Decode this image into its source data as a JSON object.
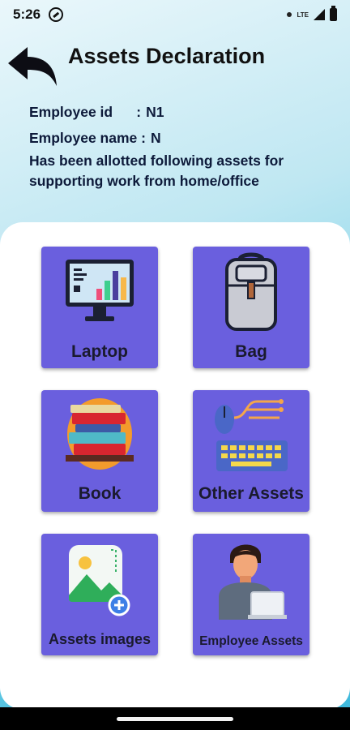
{
  "status_bar": {
    "time": "5:26",
    "network": "LTE"
  },
  "header": {
    "title": "Assets Declaration"
  },
  "employee": {
    "id_label": "Employee id      :",
    "id_value": "N1",
    "name_label": "Employee name :",
    "name_value": "N",
    "note": "Has been allotted following assets for supporting work from home/office"
  },
  "tiles": [
    {
      "label": "Laptop",
      "icon": "laptop-icon"
    },
    {
      "label": "Bag",
      "icon": "backpack-icon"
    },
    {
      "label": "Book",
      "icon": "books-icon"
    },
    {
      "label": "Other Assets",
      "icon": "keyboard-mouse-icon"
    },
    {
      "label": "Assets images",
      "icon": "image-add-icon"
    },
    {
      "label": "Employee Assets",
      "icon": "employee-laptop-icon"
    }
  ],
  "colors": {
    "tile": "#6a5fde",
    "card": "#ffffff",
    "header_gradient_end": "#3fb9dc"
  }
}
